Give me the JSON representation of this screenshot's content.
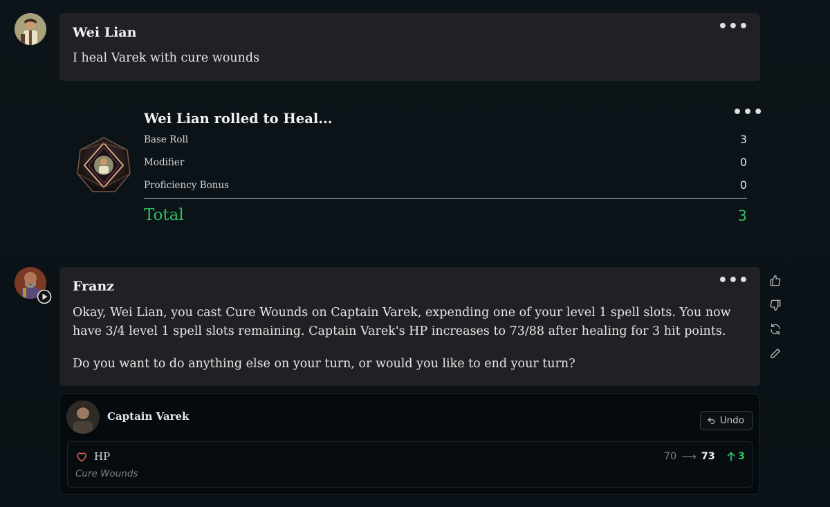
{
  "messages": {
    "player": {
      "author": "Wei Lian",
      "text": "I heal Varek with cure wounds"
    },
    "roll": {
      "title": "Wei Lian rolled to Heal...",
      "rows": [
        {
          "label": "Base Roll",
          "value": "3"
        },
        {
          "label": "Modifier",
          "value": "0"
        },
        {
          "label": "Proficiency Bonus",
          "value": "0"
        }
      ],
      "total_label": "Total",
      "total_value": "3"
    },
    "narrator": {
      "author": "Franz",
      "paragraph1": "Okay, Wei Lian, you cast Cure Wounds on Captain Varek, expending one of your level 1 spell slots. You now have 3/4 level 1 spell slots remaining. Captain Varek's HP increases to 73/88 after healing for 3 hit points.",
      "paragraph2": "Do you want to do anything else on your turn, or would you like to end your turn?"
    }
  },
  "menu": {
    "more_label": "•••"
  },
  "side_actions": {
    "icons": [
      "thumbs-up-icon",
      "thumbs-down-icon",
      "regenerate-icon",
      "edit-icon"
    ]
  },
  "state_change": {
    "character": "Captain Varek",
    "undo_label": "Undo",
    "stat_label": "HP",
    "source": "Cure Wounds",
    "old_value": "70",
    "arrow": "⟶",
    "new_value": "73",
    "delta": "3"
  },
  "colors": {
    "accent_green": "#2fbf5f",
    "heart": "#e8665c",
    "bubble_bg": "#202124",
    "page_bg": "#0b1218"
  }
}
